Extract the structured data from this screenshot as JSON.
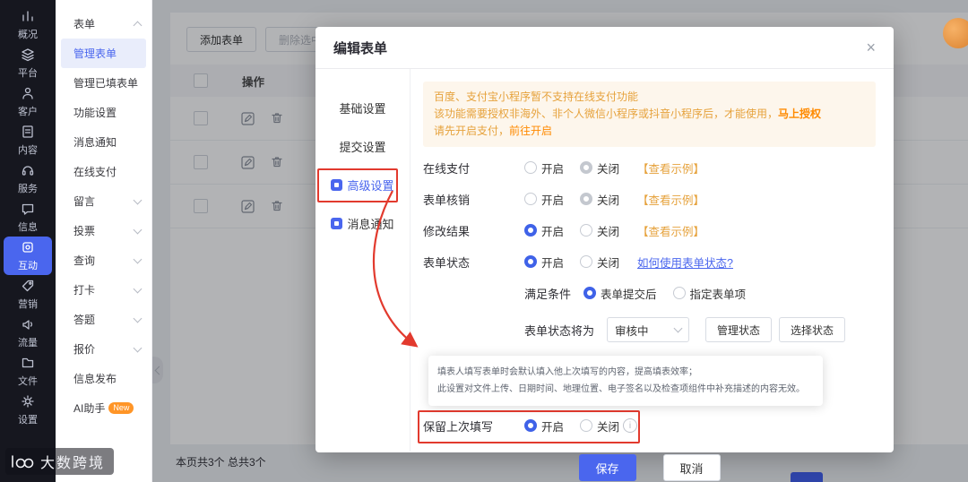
{
  "brand": {
    "watermark": "大数跨境"
  },
  "sidebar": {
    "items": [
      {
        "label": "概况"
      },
      {
        "label": "平台"
      },
      {
        "label": "客户"
      },
      {
        "label": "内容"
      },
      {
        "label": "服务"
      },
      {
        "label": "信息"
      },
      {
        "label": "互动",
        "active": true
      },
      {
        "label": "营销"
      },
      {
        "label": "流量"
      },
      {
        "label": "文件"
      },
      {
        "label": "设置"
      }
    ]
  },
  "submenu": {
    "items": [
      {
        "label": "表单",
        "group": true,
        "expanded": true
      },
      {
        "label": "管理表单",
        "active": true
      },
      {
        "label": "管理已填表单"
      },
      {
        "label": "功能设置"
      },
      {
        "label": "消息通知"
      },
      {
        "label": "在线支付"
      },
      {
        "label": "留言",
        "group": true
      },
      {
        "label": "投票",
        "group": true
      },
      {
        "label": "查询",
        "group": true
      },
      {
        "label": "打卡",
        "group": true
      },
      {
        "label": "答题",
        "group": true
      },
      {
        "label": "报价",
        "group": true
      },
      {
        "label": "信息发布"
      },
      {
        "label": "AI助手",
        "badge": "New"
      }
    ]
  },
  "content": {
    "toolbar": {
      "add": "添加表单",
      "delete": "删除选中表单"
    },
    "table": {
      "operation_header": "操作"
    },
    "footer": {
      "summary": "本页共3个  总共3个"
    }
  },
  "modal": {
    "title": "编辑表单",
    "tabs": [
      {
        "label": "基础设置"
      },
      {
        "label": "提交设置"
      },
      {
        "label": "高级设置",
        "active": true
      },
      {
        "label": "消息通知"
      }
    ],
    "notice": {
      "line1": "百度、支付宝小程序暂不支持在线支付功能",
      "line2": "该功能需要授权非海外、非个人微信小程序或抖音小程序后，才能使用，",
      "line2_link": "马上授权",
      "line3": "请先开启支付，",
      "line3_link": "前往开启"
    },
    "labels": {
      "on": "开启",
      "off": "关闭"
    },
    "fields": {
      "online_pay": {
        "label": "在线支付",
        "example": "【查看示例】"
      },
      "verification": {
        "label": "表单核销",
        "example": "【查看示例】"
      },
      "modify_result": {
        "label": "修改结果",
        "example": "【查看示例】"
      },
      "form_status": {
        "label": "表单状态",
        "help_link": "如何使用表单状态?"
      },
      "condition": {
        "label": "满足条件",
        "option1": "表单提交后",
        "option2": "指定表单项"
      },
      "status_will_be": {
        "label": "表单状态将为",
        "value": "审核中",
        "manage_button": "管理状态",
        "select_button": "选择状态"
      },
      "keep_last": {
        "label": "保留上次填写"
      }
    },
    "tooltip": {
      "line1": "填表人填写表单时会默认填入他上次填写的内容，提高填表效率；",
      "line2": "此设置对文件上传、日期时间、地理位置、电子签名以及检查项组件中补充描述的内容无效。"
    },
    "footer": {
      "save": "保存",
      "cancel": "取消"
    }
  }
}
